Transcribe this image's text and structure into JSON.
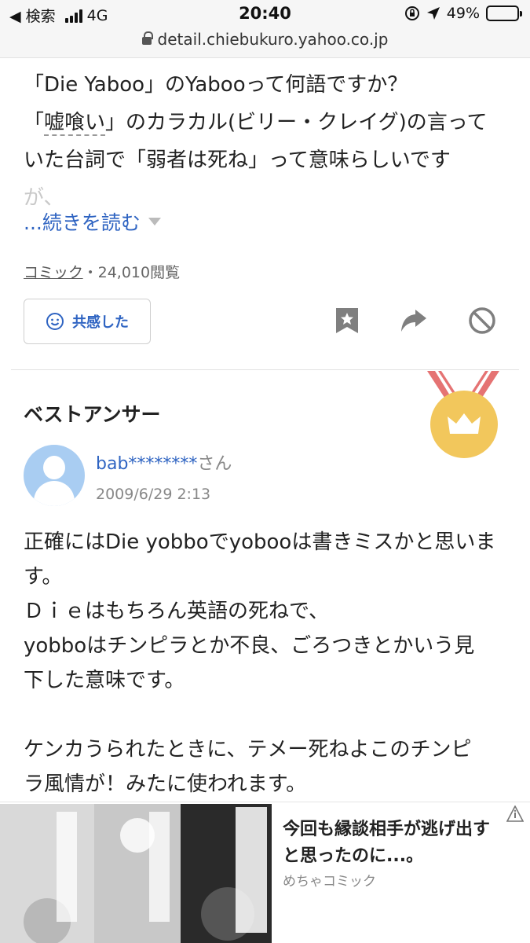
{
  "status_bar": {
    "back_label": "◀ 検索",
    "network": "4G",
    "time": "20:40",
    "battery_percent": "49%",
    "battery_level": 0.49,
    "url": "detail.chiebukuro.yahoo.co.jp"
  },
  "question": {
    "line1": "「Die Yaboo」のYabooって何語ですか？",
    "line2_pre": "「",
    "line2_term": "嘘喰い",
    "line2_post": "」のカラカル(ビリー・クレイグ)の言って",
    "line3": "いた台詞で「弱者は死ね」って意味らしいです",
    "line4_faded": "が、",
    "read_more": "...続きを読む",
    "category": "コミック",
    "views": "・24,010閲覧",
    "empathy_label": "共感した"
  },
  "best_answer": {
    "heading": "ベストアンサー",
    "username": "bab********",
    "suffix": "さん",
    "date": "2009/6/29 2:13",
    "text": "正確にはDie yobboでyobooは書きミスかと思いま\nす。\nＤｉｅはもちろん英語の死ねで、\nyobboはチンピラとか不良、ごろつきとかいう見\n下した意味です。\n\nケンカうられたときに、テメー死ねよこのチンピ\nラ風情が！みたに使われます。"
  },
  "ad": {
    "title": "今回も縁談相手が逃げ出すと思ったのに...。",
    "source": "めちゃコミック"
  },
  "colors": {
    "link_blue": "#2f64c2",
    "medal_gold": "#f2c75c",
    "ribbon_red": "#e57373",
    "avatar_blue": "#a9cdf2"
  }
}
